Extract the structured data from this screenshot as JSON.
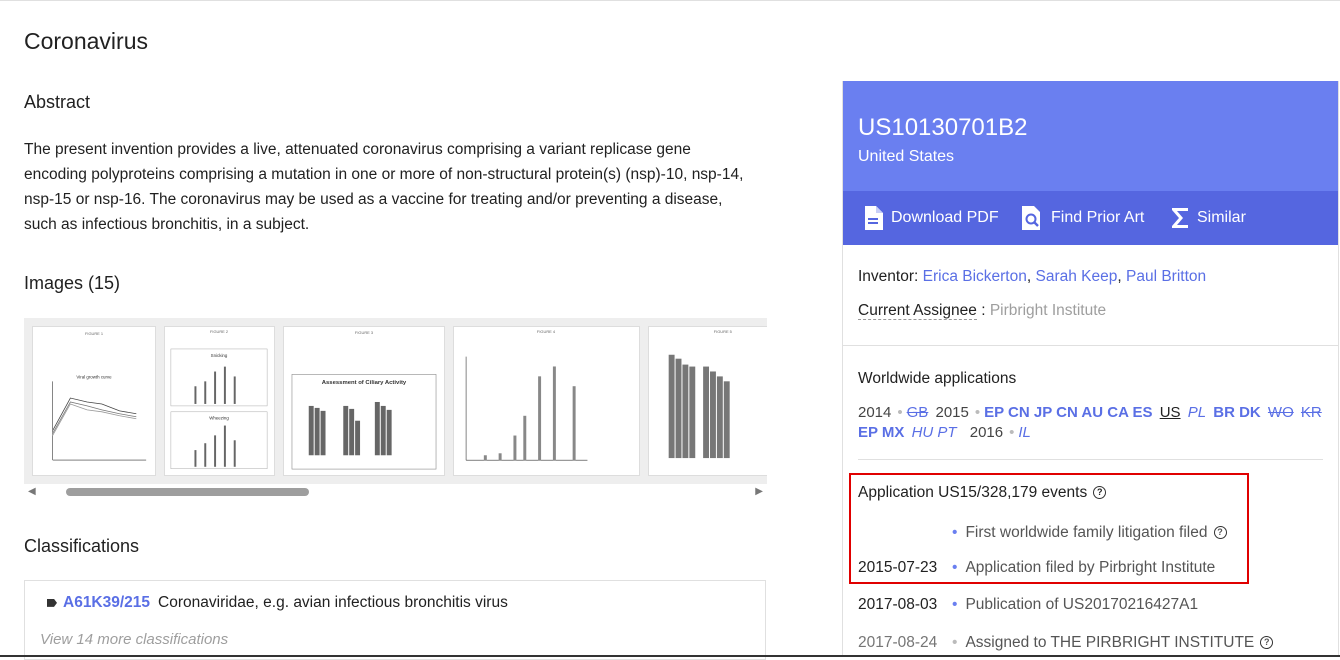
{
  "title": "Coronavirus",
  "abstract": {
    "heading": "Abstract",
    "text": "The present invention provides a live, attenuated coronavirus comprising a variant replicase gene encoding polyproteins comprising a mutation in one or more of non-structural protein(s) (nsp)-10, nsp-14, nsp-15 or nsp-16. The coronavirus may be used as a vaccine for treating and/or preventing a disease, such as infectious bronchitis, in a subject."
  },
  "images": {
    "heading": "Images (15)",
    "thumbs": [
      {
        "caption": "FIGURE 1",
        "inner": "Viral growth curve"
      },
      {
        "caption": "FIGURE 2",
        "inner_top": "Snicking",
        "inner_bottom": "Wheezing"
      },
      {
        "caption": "FIGURE 3",
        "inner": "Assessment of Ciliary Activity"
      },
      {
        "caption": "FIGURE 4"
      },
      {
        "caption": "FIGURE 5"
      }
    ]
  },
  "classifications": {
    "heading": "Classifications",
    "items": [
      {
        "code": "A61K39/215",
        "desc": "Coronaviridae, e.g. avian infectious bronchitis virus"
      }
    ],
    "more": "View 14 more classifications"
  },
  "patent": {
    "number": "US10130701B2",
    "country": "United States",
    "actions": {
      "download": "Download PDF",
      "prior_art": "Find Prior Art",
      "similar": "Similar"
    },
    "inventor_label": "Inventor:",
    "inventors": [
      "Erica Bickerton",
      "Sarah Keep",
      "Paul Britton"
    ],
    "assignee_label": "Current Assignee",
    "assignee_sep": ":",
    "assignee": "Pirbright Institute"
  },
  "worldwide": {
    "heading": "Worldwide applications",
    "y2014": "2014",
    "gb": "GB",
    "y2015": "2015",
    "c2015_bold": "EP CN JP CN AU CA ES",
    "us": "US",
    "pl": "PL",
    "c2015_bold2": "BR DK",
    "wo": "WO",
    "kr": "KR",
    "c2015_bold3": "EP MX",
    "hu_pt": "HU PT",
    "y2016": "2016",
    "il": "IL"
  },
  "events": {
    "heading": "Application US15/328,179 events",
    "help_glyph": "?",
    "rows": [
      {
        "date": "",
        "text": "First worldwide family litigation filed",
        "help": true
      },
      {
        "date": "2015-07-23",
        "text": "Application filed by Pirbright Institute"
      },
      {
        "date": "2017-08-03",
        "text": "Publication of US20170216427A1"
      },
      {
        "date": "2017-08-24",
        "text": "Assigned to THE PIRBRIGHT INSTITUTE",
        "help": true
      }
    ]
  },
  "colors": {
    "accent": "#6a7ff0",
    "accent_dark": "#5566e0",
    "link": "#5a6fe5",
    "highlight": "#e00000"
  }
}
